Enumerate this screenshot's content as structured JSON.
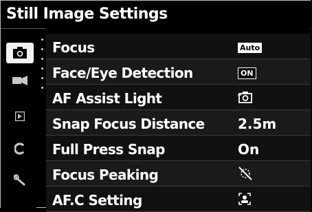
{
  "header": {
    "title": "Still Image Settings"
  },
  "sidebar": {
    "items": [
      {
        "icon": "camera-icon",
        "active": true
      },
      {
        "icon": "video-camera-icon",
        "active": false
      },
      {
        "icon": "playback-icon",
        "active": false
      },
      {
        "icon": "custom-c-icon",
        "active": false
      },
      {
        "icon": "wrench-icon",
        "active": false
      }
    ]
  },
  "menu": {
    "items": [
      {
        "label": "Focus",
        "value": "Auto",
        "value_type": "chip"
      },
      {
        "label": "Face/Eye Detection",
        "value": "ON",
        "value_type": "chip-dark"
      },
      {
        "label": "AF Assist Light",
        "value_icon": "af-assist-light-icon",
        "value_type": "icon"
      },
      {
        "label": "Snap Focus Distance",
        "value": "2.5m",
        "value_type": "text"
      },
      {
        "label": "Full Press Snap",
        "value": "On",
        "value_type": "text"
      },
      {
        "label": "Focus Peaking",
        "value_icon": "focus-peaking-off-icon",
        "value_type": "icon"
      },
      {
        "label": "AF.C Setting",
        "value_icon": "af-c-person-icon",
        "value_type": "icon"
      }
    ]
  },
  "colors": {
    "background": "#000000",
    "text": "#ffffff",
    "active_tab": "#f3f3f3",
    "separator": "#3b3b3b"
  }
}
